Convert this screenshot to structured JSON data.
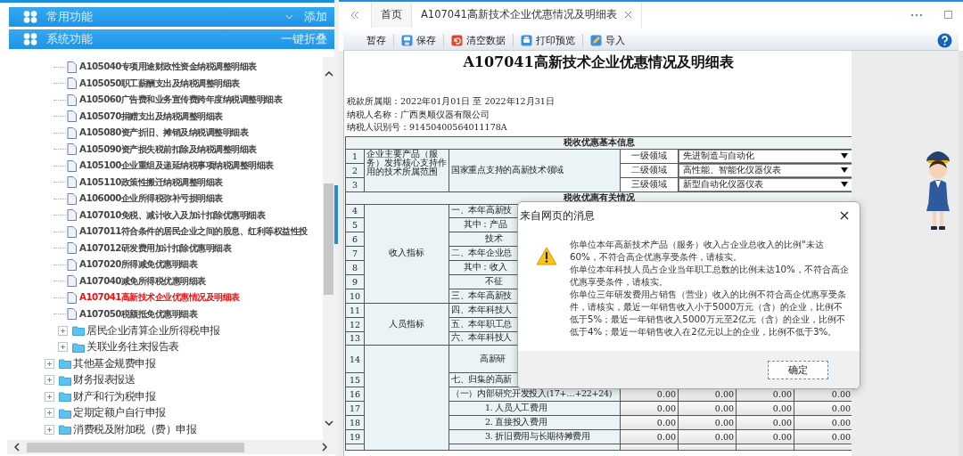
{
  "sidebar": {
    "sections": [
      {
        "title": "常用功能",
        "action": "添加",
        "kind": "dropdown"
      },
      {
        "title": "系统功能",
        "action": "一键折叠",
        "kind": "plain"
      }
    ],
    "tree": [
      {
        "children": [
          {
            "children": [
              {
                "label": "A105040专项用途财政性资金纳税调整明细表",
                "kind": "file",
                "selected": false
              },
              {
                "label": "A105050职工薪酬支出及纳税调整明细表",
                "kind": "file",
                "selected": false
              },
              {
                "label": "A105060广告费和业务宣传费跨年度纳税调整明细表",
                "kind": "file",
                "selected": false
              },
              {
                "label": "A105070捐赠支出及纳税调整明细表",
                "kind": "file",
                "selected": false
              },
              {
                "label": "A105080资产折旧、摊销及纳税调整明细表",
                "kind": "file",
                "selected": false
              },
              {
                "label": "A105090资产损失税前扣除及纳税调整明细表",
                "kind": "file",
                "selected": false
              },
              {
                "label": "A105100企业重组及递延纳税事项纳税调整明细表",
                "kind": "file",
                "selected": false
              },
              {
                "label": "A105110政策性搬迁纳税调整明细表",
                "kind": "file",
                "selected": false
              },
              {
                "label": "A106000企业所得税弥补亏损明细表",
                "kind": "file",
                "selected": false
              },
              {
                "label": "A107010免税、减计收入及加计扣除优惠明细表",
                "kind": "file",
                "selected": false
              },
              {
                "label": "A107011符合条件的居民企业之间的股息、红利等权益性投",
                "kind": "file",
                "selected": false
              },
              {
                "label": "A107012研发费用加计扣除优惠明细表",
                "kind": "file",
                "selected": false
              },
              {
                "label": "A107020所得减免优惠明细表",
                "kind": "file",
                "selected": false
              },
              {
                "label": "A107040减免所得税优惠明细表",
                "kind": "file",
                "selected": false
              },
              {
                "label": "A107041高新技术企业优惠情况及明细表",
                "kind": "file",
                "selected": true
              },
              {
                "label": "A107050税额抵免优惠明细表",
                "kind": "file",
                "selected": false
              }
            ]
          },
          {
            "label": "居民企业清算企业所得税申报",
            "kind": "folder",
            "expanded": false
          },
          {
            "label": "关联业务往来报告表",
            "kind": "folder",
            "expanded": false
          }
        ]
      },
      {
        "label": "其他基金规费申报",
        "kind": "folder",
        "expanded": false
      },
      {
        "label": "财务报表报送",
        "kind": "folder",
        "expanded": false
      },
      {
        "label": "财产和行为税申报",
        "kind": "folder",
        "expanded": false
      },
      {
        "label": "定期定额户自行申报",
        "kind": "folder",
        "expanded": false
      },
      {
        "label": "消费税及附加税（费）申报",
        "kind": "folder",
        "expanded": false
      }
    ]
  },
  "tabs": [
    {
      "label": "首页",
      "selected": false,
      "closable": false
    },
    {
      "label": "A107041高新技术企业优惠情况及明细表",
      "selected": true,
      "closable": true
    }
  ],
  "toolbar": [
    {
      "label": "暂存",
      "kind": "plain"
    },
    {
      "label": "保存",
      "kind": "save"
    },
    {
      "label": "清空数据",
      "kind": "clear"
    },
    {
      "label": "打印预览",
      "kind": "print"
    },
    {
      "label": "导入",
      "kind": "import"
    }
  ],
  "form": {
    "title": "A107041高新技术企业优惠情况及明细表",
    "info": [
      "税款所属期：2022年01月01日 至 2022年12月31日",
      "纳税人名称：广西奥顺仪器有限公司",
      "纳税人识别号：91450400564011178A"
    ],
    "basic": {
      "heading": "税收优惠基本信息",
      "category": "企业主要产品（服务）发挥核心支持作用的技术所属范围",
      "field": "国家重点支持的高新技术领域",
      "rows": [
        {
          "no": "1",
          "tier": "一级领域",
          "value": "先进制造与自动化"
        },
        {
          "no": "2",
          "tier": "二级领域",
          "value": "高性能、智能化仪器仪表"
        },
        {
          "no": "3",
          "tier": "三级领域",
          "value": "新型自动化仪器仪表"
        }
      ]
    },
    "details": {
      "heading": "税收优惠有关情况",
      "groups": [
        {
          "category": "收入指标",
          "rows": [
            {
              "no": "4",
              "label": "一、本年高新技",
              "kind": "main"
            },
            {
              "no": "5",
              "label": "其中：产品",
              "kind": "sub"
            },
            {
              "no": "6",
              "label": "技术",
              "kind": "subsub"
            },
            {
              "no": "7",
              "label": "二、本年企业总",
              "kind": "main"
            },
            {
              "no": "8",
              "label": "其中：收入",
              "kind": "sub"
            },
            {
              "no": "9",
              "label": "不征",
              "kind": "subsub"
            },
            {
              "no": "10",
              "label": "三、本年高新技",
              "kind": "main"
            }
          ]
        },
        {
          "category": "人员指标",
          "rows": [
            {
              "no": "11",
              "label": "四、本年科技人",
              "kind": "main"
            },
            {
              "no": "12",
              "label": "五、本年职工总",
              "kind": "main"
            },
            {
              "no": "13",
              "label": "六、本年科技人",
              "kind": "main"
            }
          ]
        },
        {
          "rows": [
            {
              "no": "14",
              "label": "高新研",
              "kind": "center"
            },
            {
              "no": "15",
              "label": "七、归集的高新",
              "kind": "main"
            },
            {
              "no": "16",
              "label": "（一）内部研究开发投入(17+…+22+24)",
              "kind": "main",
              "values": [
                "0.00",
                "0.00",
                "0.00",
                "0.00"
              ]
            },
            {
              "no": "17",
              "label": "1. 人员人工费用",
              "kind": "subsub",
              "values": [
                "0.00",
                "0.00",
                "0.00",
                "0.00"
              ]
            },
            {
              "no": "18",
              "label": "2. 直接投入费用",
              "kind": "subsub",
              "values": [
                "0.00",
                "0.00",
                "0.00",
                "0.00"
              ]
            },
            {
              "no": "19",
              "label": "3. 折旧费用与长期待摊费用",
              "kind": "subsub",
              "values": [
                "0.00",
                "0.00",
                "0.00",
                "0.00"
              ]
            }
          ]
        }
      ]
    }
  },
  "dialog": {
    "title": "来自网页的消息",
    "messages": [
      "你单位本年高新技术产品（服务）收入占企业总收入的比例\"未达60%，不符合高企优惠享受条件，请核实。",
      "你单位本年科技人员占企业当年职工总数的比例未达10%，不符合高企优惠享受条件，请核实。",
      "你单位三年研发费用占销售（营业）收入的比例不符合高企优惠享受条件，请核实，最近一年销售收入小于5000万元（含）的企业，比例不低于5%；最近一年销售收入5000万元至2亿元（含）的企业，比例不低于4%；最近一年销售收入在2亿元以上的企业，比例不低于3%。"
    ],
    "button": "确定"
  }
}
